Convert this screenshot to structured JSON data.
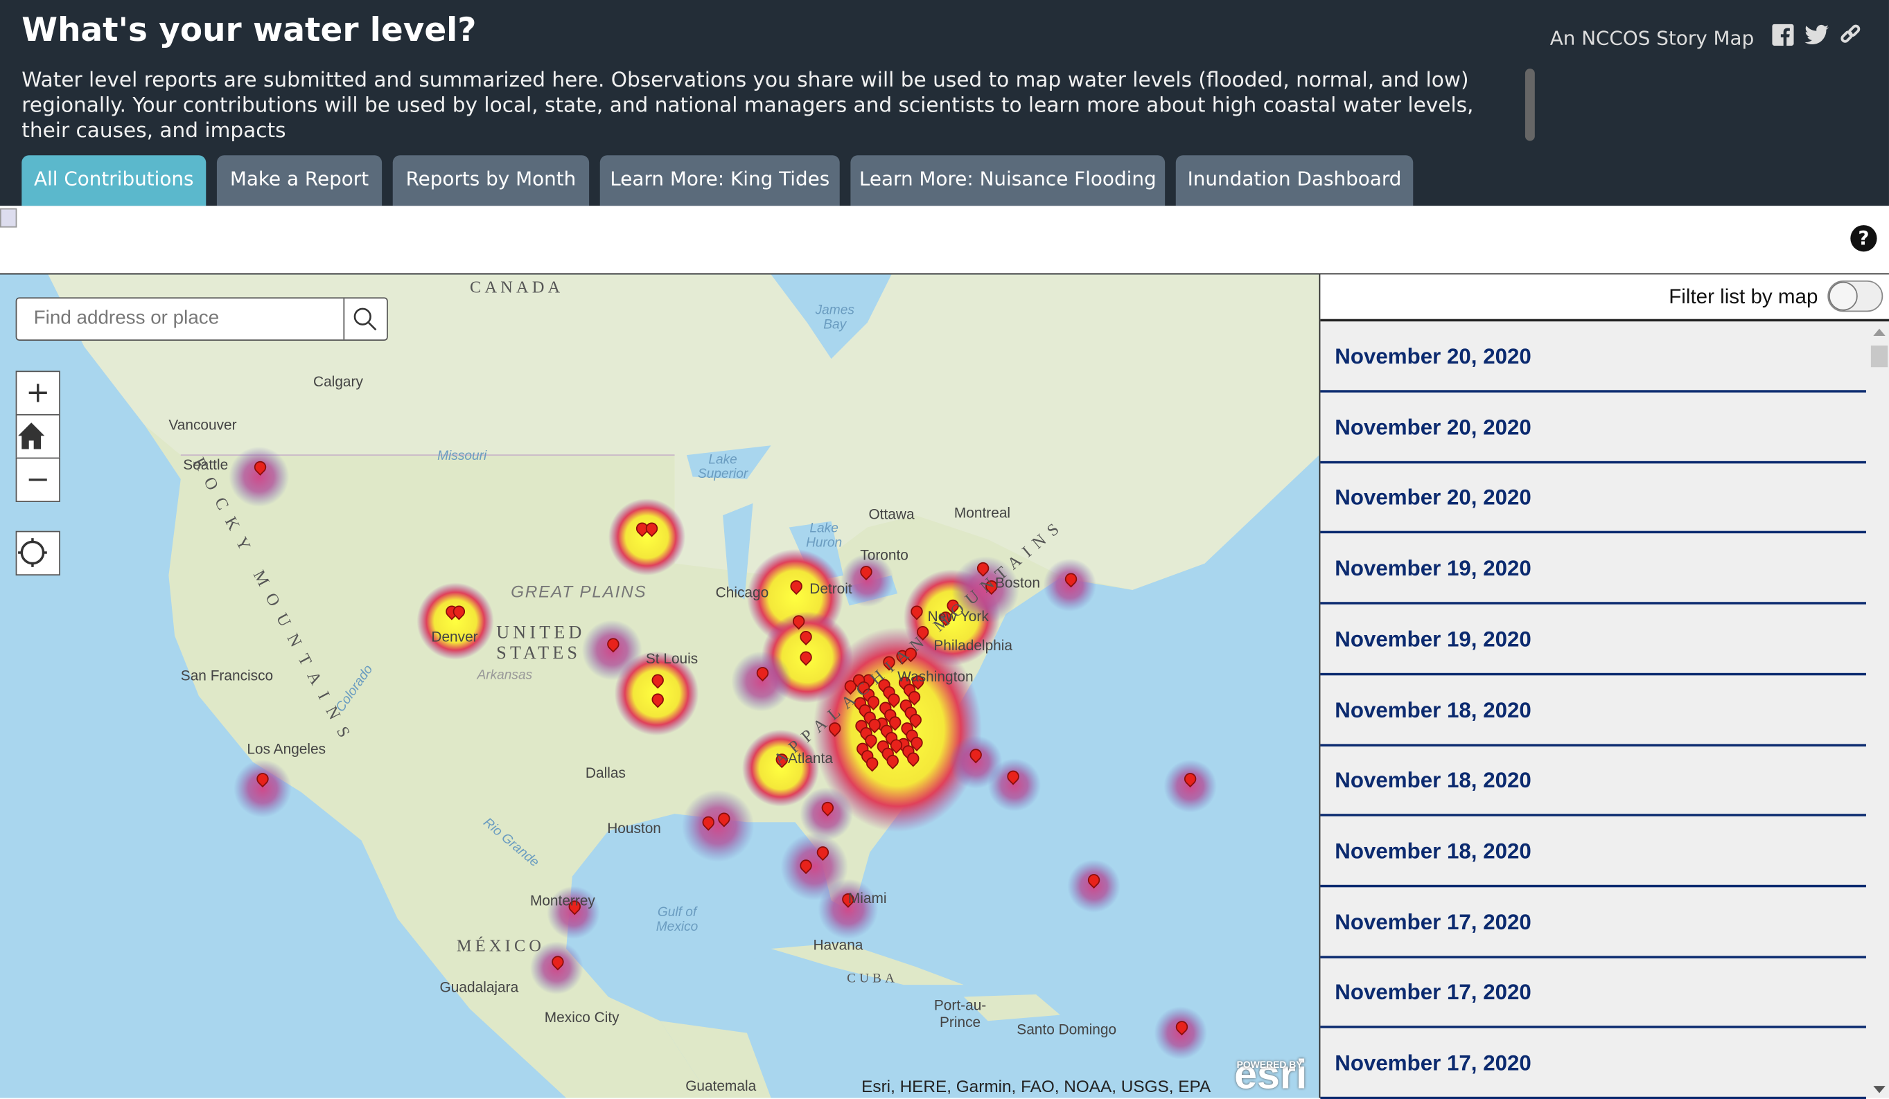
{
  "header": {
    "title": "What's your water level?",
    "description": "Water level reports are submitted and summarized here. Observations you share will be used to map water levels (flooded, normal, and low) regionally. Your contributions will be used by local, state, and national managers and scientists to learn more about high coastal water levels, their causes, and impacts",
    "brand": "An NCCOS Story Map",
    "social": [
      "facebook-icon",
      "twitter-icon",
      "link-icon"
    ]
  },
  "tabs": [
    {
      "label": "All Contributions",
      "active": true
    },
    {
      "label": "Make a Report"
    },
    {
      "label": "Reports by Month"
    },
    {
      "label": "Learn More: King Tides"
    },
    {
      "label": "Learn More: Nuisance Flooding"
    },
    {
      "label": "Inundation Dashboard"
    }
  ],
  "toolbar": {
    "help": "?"
  },
  "map": {
    "search_placeholder": "Find address or place",
    "zoom_in": "+",
    "zoom_out": "−",
    "attribution": "Esri, HERE, Garmin, FAO, NOAA, USGS, EPA",
    "esri_powered": "POWERED BY",
    "esri": "esri",
    "labels": [
      "CANADA",
      "Calgary",
      "Vancouver",
      "Seattle",
      "Missouri",
      "Lake Superior",
      "James Bay",
      "Ottawa",
      "Montreal",
      "Lake Huron",
      "Toronto",
      "Chicago",
      "Detroit",
      "Boston",
      "New York",
      "Philadelphia",
      "Washington",
      "GREAT PLAINS",
      "UNITED STATES",
      "Denver",
      "St Louis",
      "Arkansas",
      "San Francisco",
      "Colorado",
      "Los Angeles",
      "Dallas",
      "Houston",
      "Rio Grande",
      "Atlanta",
      "Miami",
      "Monterrey",
      "Gulf of Mexico",
      "MÉXICO",
      "Havana",
      "CUBA",
      "Guadalajara",
      "Mexico City",
      "Port-au-Prince",
      "Santo Domingo",
      "Guatemala",
      "ROCKY MOUNTAINS",
      "APPALACHIAN MOUNTAINS"
    ]
  },
  "sidebar": {
    "filter_label": "Filter list by map",
    "filter_on": false,
    "items": [
      "November 20, 2020",
      "November 20, 2020",
      "November 20, 2020",
      "November 19, 2020",
      "November 19, 2020",
      "November 18, 2020",
      "November 18, 2020",
      "November 18, 2020",
      "November 17, 2020",
      "November 17, 2020",
      "November 17, 2020"
    ]
  }
}
